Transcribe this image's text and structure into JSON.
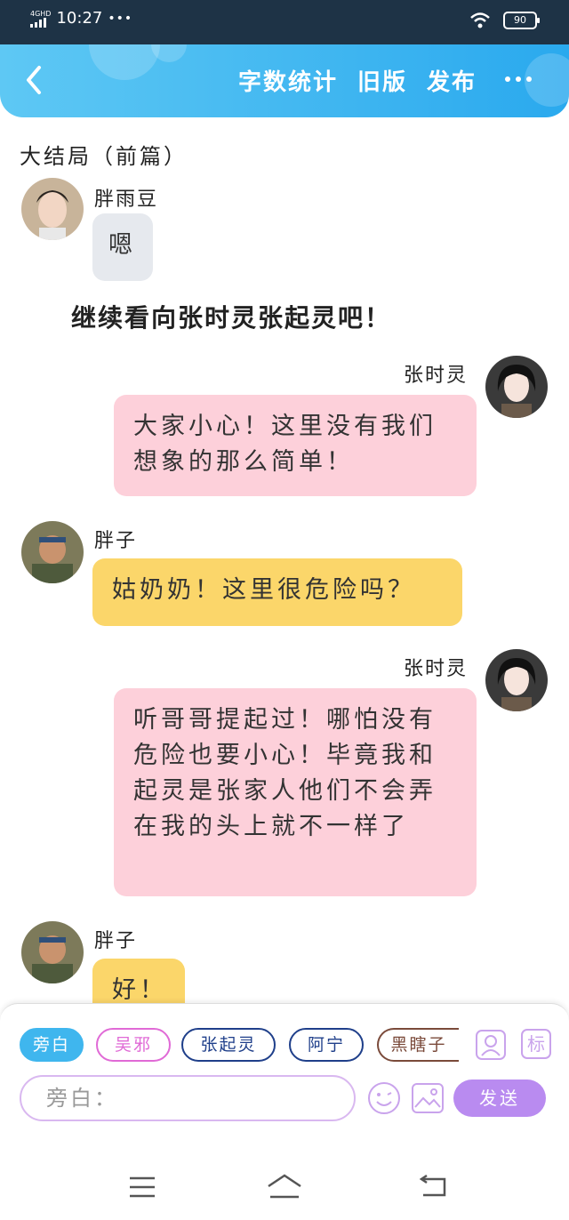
{
  "status_bar": {
    "network": "4GHD",
    "time": "10:27",
    "dots": "•••",
    "battery": "90"
  },
  "header": {
    "actions": [
      "字数统计",
      "旧版",
      "发布"
    ],
    "icons": [
      "chevron-left-icon",
      "more-icon"
    ]
  },
  "chapter_title": "大结局（前篇）",
  "messages": [
    {
      "speaker": "胖雨豆",
      "side": "left",
      "text": "嗯",
      "style": "gray"
    },
    {
      "type": "narration",
      "text": "继续看向张时灵张起灵吧！"
    },
    {
      "speaker": "张时灵",
      "side": "right",
      "text": "大家小心！这里没有我们想象的那么简单！",
      "style": "pink"
    },
    {
      "speaker": "胖子",
      "side": "left",
      "text": "姑奶奶！这里很危险吗？",
      "style": "yellow"
    },
    {
      "speaker": "张时灵",
      "side": "right",
      "text": "听哥哥提起过！哪怕没有危险也要小心！毕竟我和起灵是张家人他们不会弄在我的头上就不一样了",
      "style": "pink"
    },
    {
      "speaker": "胖子",
      "side": "left",
      "text": "好！",
      "style": "yellow"
    }
  ],
  "composer": {
    "roles": [
      "旁白",
      "吴邪",
      "张起灵",
      "阿宁",
      "黑瞎子"
    ],
    "selected_role": "旁白",
    "role_colors": [
      "#3fb6ee",
      "#e06ad6",
      "#1f3f8a",
      "#1f3f8a",
      "#7a4a3a"
    ],
    "input_placeholder": "旁白：",
    "send_label": "发送",
    "tag_label": "标"
  },
  "navbar": {
    "icons": [
      "menu-icon",
      "home-icon",
      "back-icon"
    ]
  }
}
